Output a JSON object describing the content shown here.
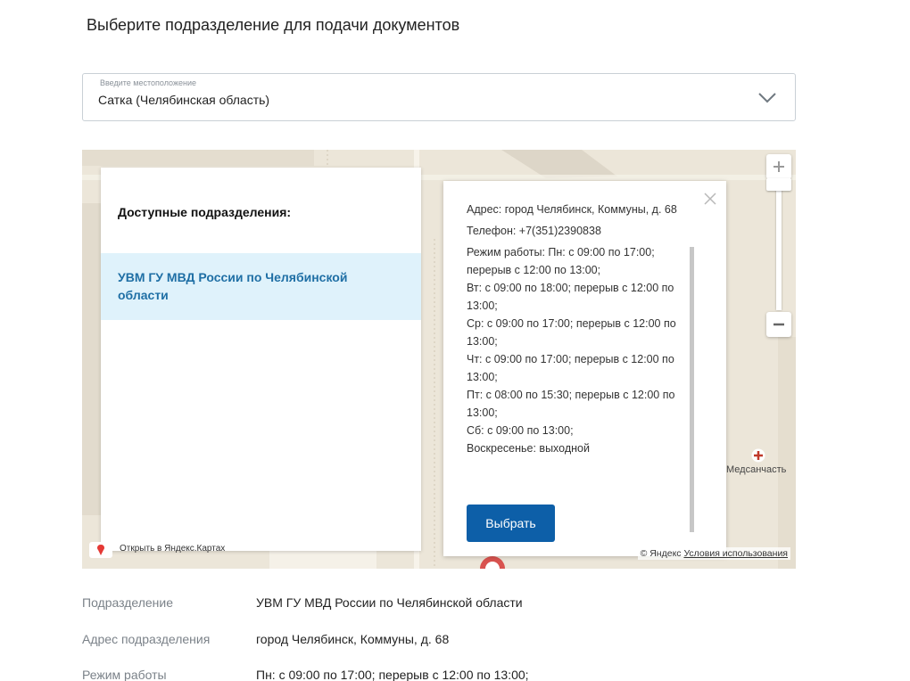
{
  "page": {
    "title": "Выберите подразделение для подачи документов"
  },
  "location": {
    "label": "Введите местоположение",
    "value": "Сатка (Челябинская область)"
  },
  "map": {
    "list": {
      "heading": "Доступные подразделения:",
      "items": [
        "УВМ ГУ МВД России по Челябинской области"
      ]
    },
    "info": {
      "address": "Адрес: город Челябинск, Коммуны, д. 68",
      "phone": "Телефон: +7(351)2390838",
      "hours": [
        "Режим работы: Пн: с 09:00 по 17:00; перерыв с 12:00 по 13:00;",
        "Вт: с 09:00 по 18:00; перерыв с 12:00 по 13:00;",
        "Ср: с 09:00 по 17:00; перерыв с 12:00 по 13:00;",
        "Чт: с 09:00 по 17:00; перерыв с 12:00 по 13:00;",
        "Пт: с 08:00 по 15:30; перерыв с 12:00 по 13:00;",
        "Сб: с 09:00 по 13:00;",
        "Воскресенье: выходной"
      ],
      "select_button": "Выбрать"
    },
    "poi_label": "Медсанчасть",
    "open_in_yandex": "Открыть в Яндекс.Картах",
    "copyright": "© Яндекс",
    "terms": "Условия использования",
    "colors": {
      "select_button": "#0d5fa8",
      "list_item_bg": "#dff2fb",
      "list_item_text": "#1f6fa5"
    }
  },
  "details": {
    "rows": [
      {
        "label": "Подразделение",
        "value": "УВМ ГУ МВД России по Челябинской области"
      },
      {
        "label": "Адрес подразделения",
        "value": "город Челябинск, Коммуны, д. 68"
      },
      {
        "label": "Режим работы",
        "value": "Пн: с 09:00 по 17:00; перерыв с 12:00 по 13:00;"
      }
    ]
  }
}
